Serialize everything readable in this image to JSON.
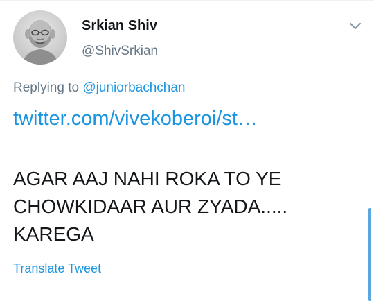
{
  "tweet": {
    "display_name": "Srkian Shiv",
    "handle": "@ShivSrkian",
    "replying_prefix": "Replying to",
    "replying_to": "@juniorbachchan",
    "link_text": "twitter.com/vivekoberoi/st…",
    "body_lines": [
      "AGAR AAJ NAHI ROKA TO YE",
      "CHOWKIDAAR AUR ZYADA.....",
      "KAREGA"
    ],
    "translate_label": "Translate Tweet"
  },
  "icons": {
    "avatar": "avatar-portrait",
    "menu": "chevron-down-icon"
  },
  "colors": {
    "accent": "#1b95e0",
    "secondary_text": "#657786",
    "primary_text": "#14171a"
  }
}
